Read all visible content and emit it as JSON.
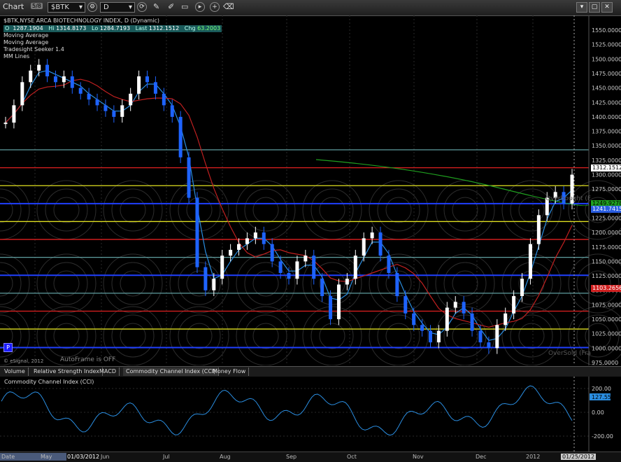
{
  "window": {
    "title": "Chart",
    "counter": "5/8",
    "symbol": "$BTK",
    "interval": "D"
  },
  "info": {
    "title": "$BTK,NYSE ARCA BIOTECHNOLOGY INDEX, D (Dynamic)",
    "o_label": "O",
    "o_value": "1287.1904",
    "hi_label": "Hi",
    "hi_value": "1314.8173",
    "lo_label": "Lo",
    "lo_value": "1284.7193",
    "last_label": "Last",
    "last_value": "1312.1512",
    "chg_label": "Chg",
    "chg_value": "63.2003",
    "studies": [
      "Moving Average",
      "Moving Average",
      "Tradesight Seeker 1.4",
      "MM Lines"
    ]
  },
  "price_axis": [
    "1550.0000",
    "1525.0000",
    "1500.0000",
    "1475.0000",
    "1450.0000",
    "1425.0000",
    "1400.0000",
    "1375.0000",
    "1350.0000",
    "1325.0000",
    "1300.0000",
    "1275.0000",
    "1250.0000",
    "1225.0000",
    "1200.0000",
    "1175.0000",
    "1150.0000",
    "1125.0000",
    "1100.0000",
    "1075.0000",
    "1050.0000",
    "1025.0000",
    "1000.0000",
    "975.0000"
  ],
  "tags": {
    "last": "1312.1512",
    "ma_green": "1249.9278",
    "ma_blue": "1241.7415",
    "ma_red": "1103.2656"
  },
  "overlay_text": {
    "oversold": "OverSold (Fra",
    "overbought": "Overbought (F",
    "autoframe": "AutoFrame is OFF",
    "copyright": "© eSignal, 2012",
    "p": "P"
  },
  "tabs": [
    "Volume",
    "Relative Strength Index",
    "MACD",
    "Commodity Channel Index (CCI)",
    "Money Flow"
  ],
  "cci": {
    "title": "Commodity Channel Index (CCI)",
    "axis": [
      "200.00",
      "0.00",
      "-200.00"
    ],
    "last": "127.55"
  },
  "dates": {
    "labels": [
      "Date",
      "May",
      "Jun",
      "Jul",
      "Aug",
      "Sep",
      "Oct",
      "Nov",
      "Dec",
      "2012"
    ],
    "cursor": "01/03/2012",
    "last": "01/25/2012"
  },
  "colors": {
    "up": "#ffffff",
    "down": "#1e63ff",
    "ma_fast": "#2a8de0",
    "ma_slow": "#c02020",
    "ma_long": "#1f9f1f",
    "setup_green": "#22c022",
    "setup_red": "#ff2020"
  }
}
